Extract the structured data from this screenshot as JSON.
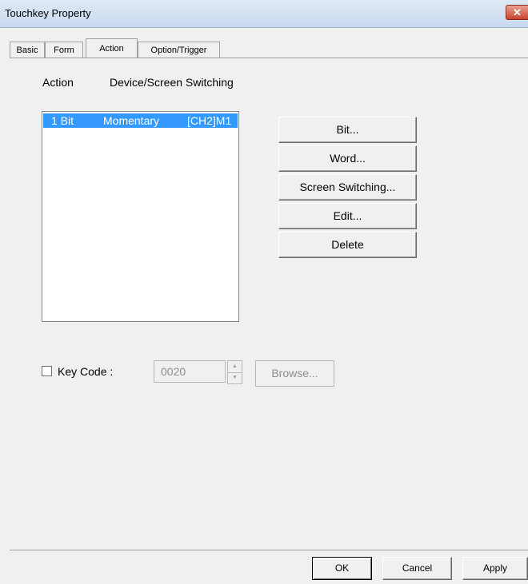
{
  "window": {
    "title": "Touchkey Property",
    "close_glyph": "✕",
    "close_icon": "close-icon"
  },
  "tabs": [
    {
      "label": "Basic"
    },
    {
      "label": "Form"
    },
    {
      "label": "Action",
      "active": true
    },
    {
      "label": "Option/Trigger"
    }
  ],
  "action_section": {
    "action_label": "Action",
    "type_label": "Device/Screen Switching"
  },
  "action_list": {
    "rows": [
      {
        "kind": "1 Bit",
        "mode": "Momentary",
        "device": "[CH2]M1",
        "selected": true
      }
    ]
  },
  "side_buttons": {
    "bit": "Bit...",
    "word": "Word...",
    "screen_switching": "Screen Switching...",
    "edit": "Edit...",
    "delete": "Delete"
  },
  "key_code": {
    "checked": false,
    "label": "Key Code :",
    "value": "0020",
    "spin_up_glyph": "▲",
    "spin_down_glyph": "▼",
    "browse_label": "Browse..."
  },
  "footer": {
    "ok": "OK",
    "cancel": "Cancel",
    "apply": "Apply"
  }
}
